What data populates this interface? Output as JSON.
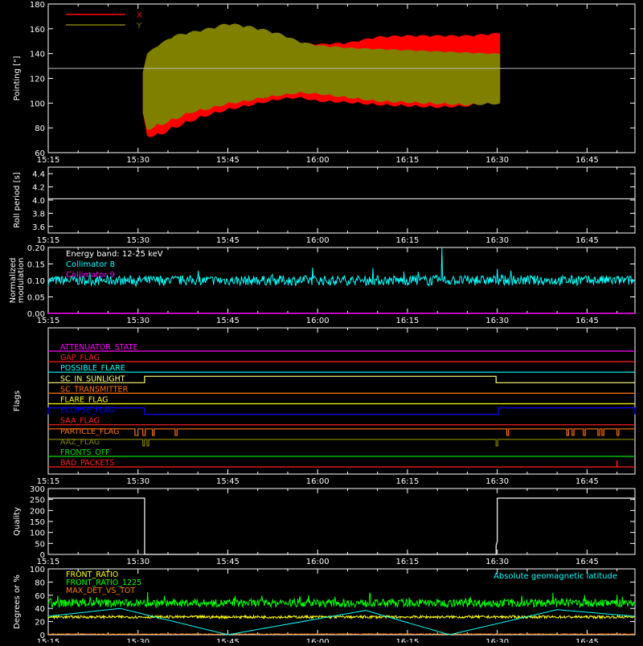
{
  "style": {
    "background": "#000000",
    "axis_color": "#ffffff"
  },
  "time_ticks": [
    "15:15",
    "15:30",
    "15:45",
    "16:00",
    "16:15",
    "16:30",
    "16:45"
  ],
  "chart_data": [
    {
      "id": "pointing",
      "type": "area",
      "ylabel": "Pointing [\"]",
      "ylim": [
        60,
        180
      ],
      "yticks": [
        60,
        80,
        100,
        120,
        140,
        160,
        180
      ],
      "xlim_minutes": [
        15,
        113
      ],
      "reference_line": 128,
      "series": [
        {
          "name": "X",
          "color": "#ff0000",
          "x": [
            30.8,
            31.5,
            33,
            36,
            39,
            42,
            45,
            48,
            51,
            54,
            57,
            60,
            65,
            70,
            75,
            80,
            85,
            90.5
          ],
          "upper": [
            124,
            138,
            142,
            141,
            149,
            151,
            150,
            148,
            150,
            146,
            149,
            148,
            149,
            154,
            155,
            155,
            155,
            157
          ],
          "lower": [
            90,
            73,
            72,
            79,
            85,
            90,
            94,
            97,
            100,
            103,
            104,
            101,
            100,
            98,
            97,
            96,
            97,
            101
          ]
        },
        {
          "name": "Y",
          "color": "#808000",
          "x": [
            30.8,
            31.5,
            33,
            36,
            39,
            42,
            45,
            48,
            51,
            54,
            57,
            60,
            65,
            70,
            75,
            80,
            85,
            90.5
          ],
          "upper": [
            125,
            140,
            146,
            155,
            158,
            161,
            165,
            163,
            160,
            156,
            150,
            147,
            145,
            144,
            143,
            142,
            141,
            140
          ],
          "lower": [
            90,
            78,
            80,
            86,
            92,
            95,
            99,
            101,
            104,
            106,
            108,
            107,
            104,
            101,
            100,
            99,
            98,
            99
          ]
        }
      ]
    },
    {
      "id": "roll_period",
      "type": "line",
      "ylabel": "Roll period [s]",
      "ylim": [
        3.5,
        4.5
      ],
      "yticks": [
        "3.6",
        "3.8",
        "4.0",
        "4.2",
        "4.4"
      ],
      "xlim_minutes": [
        15,
        113
      ],
      "series": [
        {
          "name": "",
          "color": "#ffffff",
          "x": [
            15,
            113
          ],
          "values": [
            4.02,
            4.02
          ]
        }
      ]
    },
    {
      "id": "modulation",
      "type": "line",
      "ylabel": "Normalized modulation",
      "ylim": [
        0,
        0.2
      ],
      "yticks": [
        "0.00",
        "0.05",
        "0.10",
        "0.15",
        "0.20"
      ],
      "xlim_minutes": [
        15,
        113
      ],
      "annotation": "Energy band: 12-25 keV",
      "series": [
        {
          "name": "Collimator 8",
          "color": "#00ffff",
          "mean": 0.1,
          "spread": 0.015,
          "spike_at": 80.8,
          "spike_value": 0.2
        },
        {
          "name": "Collimator 9",
          "color": "#ff00ff",
          "values_constant": 0.0
        }
      ]
    },
    {
      "id": "flags",
      "type": "line",
      "ylabel": "Flags",
      "xlim_minutes": [
        15,
        113
      ],
      "series": [
        {
          "name": "ATTENUATOR_STATE",
          "color": "#ff00ff",
          "high": []
        },
        {
          "name": "GAP_FLAG",
          "color": "#ff2020",
          "high": []
        },
        {
          "name": "POSSIBLE_FLARE",
          "color": "#00ffff",
          "high": []
        },
        {
          "name": "SC_IN_SUNLIGHT",
          "color": "#ffff80",
          "high": [
            [
              31.1,
              89.8
            ]
          ]
        },
        {
          "name": "SC_TRANSMITTER",
          "color": "#ff7000",
          "high": []
        },
        {
          "name": "FLARE_FLAG",
          "color": "#ffff00",
          "high": []
        },
        {
          "name": "ECLIPSE_FLAG",
          "color": "#0000ff",
          "high": [
            [
              15,
              31.1
            ],
            [
              90.2,
              113
            ]
          ]
        },
        {
          "name": "SAA_FLAG",
          "color": "#ff2020",
          "high": []
        },
        {
          "name": "PARTICLE_FLAG",
          "color": "#ff7000",
          "low": [
            [
              29.5,
              30
            ],
            [
              30.8,
              31.2
            ],
            [
              32.4,
              32.7
            ],
            [
              36.2,
              36.5
            ],
            [
              91.6,
              91.9
            ],
            [
              101.6,
              101.9
            ],
            [
              102.5,
              102.8
            ],
            [
              104.4,
              104.7
            ],
            [
              106.8,
              107.1
            ],
            [
              107.5,
              107.8
            ],
            [
              110,
              110.3
            ]
          ]
        },
        {
          "name": "AAZ_FLAG",
          "color": "#808000",
          "low": [
            [
              30.8,
              31.1
            ],
            [
              31.5,
              31.8
            ],
            [
              89.8,
              90.1
            ]
          ]
        },
        {
          "name": "FRONTS_OFF",
          "color": "#00e000",
          "high": []
        },
        {
          "name": "BAD_PACKETS",
          "color": "#ff2020",
          "spikes": [
            110
          ]
        }
      ]
    },
    {
      "id": "quality",
      "type": "line",
      "ylabel": "Quality",
      "ylim": [
        0,
        300
      ],
      "yticks": [
        0,
        50,
        100,
        150,
        200,
        250,
        300
      ],
      "xlim_minutes": [
        15,
        113
      ],
      "series": [
        {
          "name": "",
          "color": "#ffffff",
          "x": [
            15,
            31.1,
            31.1,
            89.8,
            89.8,
            90,
            90,
            113
          ],
          "values": [
            256,
            256,
            0,
            0,
            40,
            60,
            256,
            256
          ]
        }
      ]
    },
    {
      "id": "geomag",
      "type": "line",
      "ylabel": "Degrees or %",
      "ylim": [
        0,
        100
      ],
      "yticks": [
        0,
        20,
        40,
        60,
        80,
        100
      ],
      "xlim_minutes": [
        15,
        113
      ],
      "series": [
        {
          "name": "FRONT_RATIO",
          "color": "#ffff00",
          "mean": 27,
          "spread": 2
        },
        {
          "name": "FRONT_RATIO_1225",
          "color": "#00ff00",
          "mean": 48,
          "spread": 6
        },
        {
          "name": "MAX_DET_VS_TOT",
          "color": "#ff8000",
          "mean": 1,
          "spread": 0.5
        },
        {
          "name": "Absolute geomagnetic latitude",
          "color": "#00ffff",
          "x": [
            15,
            27,
            45,
            50,
            68,
            82,
            100,
            113
          ],
          "values": [
            28,
            40,
            0,
            8,
            37,
            0,
            38,
            28
          ]
        }
      ]
    }
  ]
}
